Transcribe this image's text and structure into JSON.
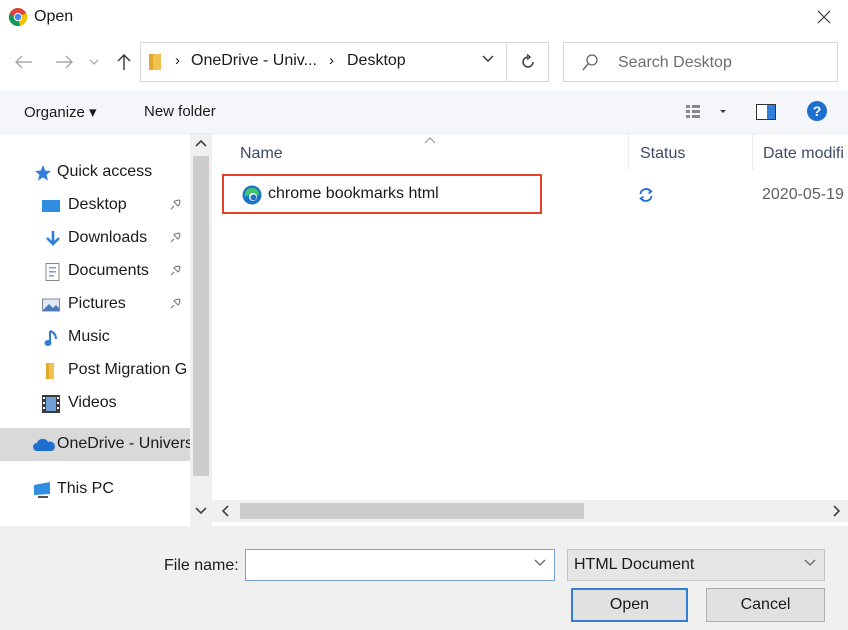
{
  "window": {
    "title": "Open"
  },
  "address": {
    "crumbs": [
      "OneDrive - Univ...",
      "Desktop"
    ],
    "search_placeholder": "Search Desktop"
  },
  "toolbar": {
    "organize_label": "Organize ▾",
    "new_folder_label": "New folder"
  },
  "sidebar": {
    "items": [
      {
        "label": "Quick access",
        "icon": "star-icon"
      },
      {
        "label": "Desktop",
        "icon": "desktop-icon",
        "pinned": true
      },
      {
        "label": "Downloads",
        "icon": "download-arrow-icon",
        "pinned": true
      },
      {
        "label": "Documents",
        "icon": "documents-icon",
        "pinned": true
      },
      {
        "label": "Pictures",
        "icon": "pictures-icon",
        "pinned": true
      },
      {
        "label": "Music",
        "icon": "music-note-icon"
      },
      {
        "label": "Post Migration G",
        "icon": "folder-icon"
      },
      {
        "label": "Videos",
        "icon": "videos-icon"
      },
      {
        "label": "OneDrive - Univers",
        "icon": "onedrive-cloud-icon",
        "selected": true
      },
      {
        "label": "This PC",
        "icon": "this-pc-icon"
      }
    ]
  },
  "columns": {
    "name": "Name",
    "status": "Status",
    "date": "Date modifi"
  },
  "files": [
    {
      "name": "chrome bookmarks html",
      "icon": "edge-icon",
      "status_icon": "sync-icon",
      "date": "2020-05-19"
    }
  ],
  "footer": {
    "filename_label": "File name:",
    "filename_value": "",
    "filetype": "HTML Document",
    "open_label": "Open",
    "cancel_label": "Cancel"
  },
  "colors": {
    "highlight_border": "#e64025",
    "accent_blue": "#2f7fd8",
    "selected_nav": "#d9d9d9"
  }
}
